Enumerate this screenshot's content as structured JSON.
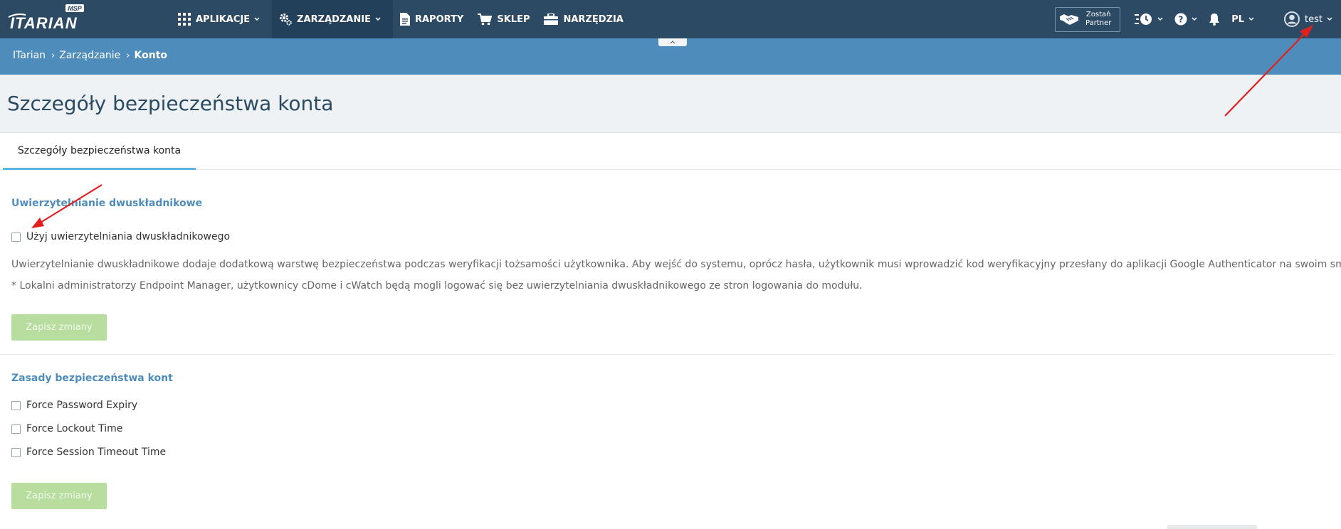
{
  "logo": {
    "text": "ITARIAN",
    "badge": "MSP"
  },
  "nav": {
    "items": [
      {
        "label": "APLIKACJE",
        "icon": "grid-icon",
        "has_dropdown": true,
        "active": false
      },
      {
        "label": "ZARZĄDZANIE",
        "icon": "gear-icon",
        "has_dropdown": true,
        "active": true
      },
      {
        "label": "RAPORTY",
        "icon": "report-icon",
        "has_dropdown": false,
        "active": false
      },
      {
        "label": "SKLEP",
        "icon": "cart-icon",
        "has_dropdown": false,
        "active": false
      },
      {
        "label": "NARZĘDZIA",
        "icon": "toolbox-icon",
        "has_dropdown": false,
        "active": false
      }
    ]
  },
  "toolbar": {
    "partner_line1": "Zostań",
    "partner_line2": "Partner",
    "language": "PL",
    "username": "test"
  },
  "breadcrumb": {
    "items": [
      "ITarian",
      "Zarządzanie"
    ],
    "current": "Konto"
  },
  "page": {
    "title": "Szczegóły bezpieczeństwa konta",
    "tab_label": "Szczegóły bezpieczeństwa konta"
  },
  "two_factor": {
    "title": "Uwierzytelnianie dwuskładnikowe",
    "checkbox_label": "Użyj uwierzytelniania dwuskładnikowego",
    "checked": false,
    "description": "Uwierzytelnianie dwuskładnikowe dodaje dodatkową warstwę bezpieczeństwa podczas weryfikacji tożsamości użytkownika. Aby wejść do systemu, oprócz hasła, użytkownik musi wprowadzić kod weryfikacyjny przesłany do aplikacji Google Authenticator na swoim smartfonie.",
    "note": "* Lokalni administratorzy Endpoint Manager, użytkownicy cDome i cWatch będą mogli logować się bez uwierzytelniania dwuskładnikowego ze stron logowania do modułu.",
    "save_label": "Zapisz zmiany"
  },
  "policies": {
    "title": "Zasady bezpieczeństwa kont",
    "options": [
      {
        "label": "Force Password Expiry",
        "checked": false
      },
      {
        "label": "Force Lockout Time",
        "checked": false
      },
      {
        "label": "Force Session Timeout Time",
        "checked": false
      }
    ],
    "save_label": "Zapisz zmiany"
  },
  "colors": {
    "topbar": "#2c4a64",
    "breadcrumb_bar": "#4e8dbb",
    "section_title": "#4e8dbb",
    "button_disabled": "#b7dd9f",
    "arrow": "#e0201e"
  }
}
